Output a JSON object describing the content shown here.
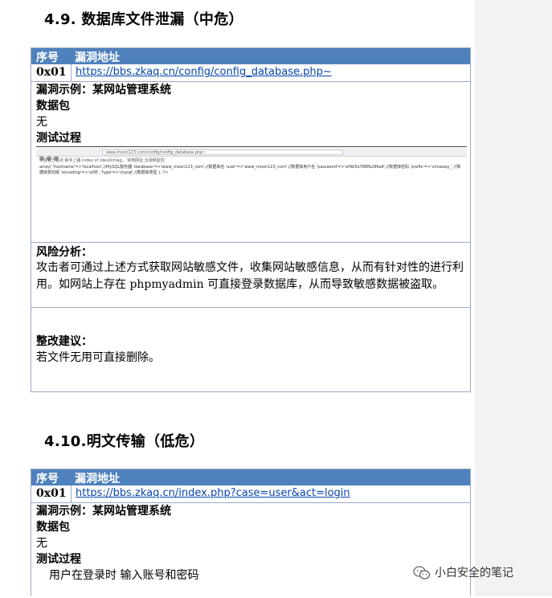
{
  "sections": [
    {
      "heading": "4.9. 数据库文件泄漏（中危）",
      "table": {
        "header": {
          "col1": "序号",
          "col2": "漏洞地址"
        },
        "row": {
          "id": "0x01",
          "url": "https://bbs.zkaq.cn/config/config_database.php~"
        },
        "example": "漏洞示例：某网站管理系统",
        "packet_label": "数据包",
        "packet_value": "无",
        "process_label": "测试过程",
        "screenshot": {
          "address": "www.moon123.com/config/config_database.php~",
          "bookmarks": "火狐官方站点   新手上路   Index of /devil/imag...   常用网址   云视频监控",
          "output": "array( 'hostname'=>'localhost',//MySQL服务器 'database'=>'www_moon123_com',//数据库名 'user'=>'www_moon123_com',//数据库用户名 'password'=>'ef4b5e788fb286a4',//数据库密码 'prefix'=>'cmseasy_',//数据库表前缀 'encoding'=>'utf8', 'type'=>'mysql',//数据库类型 ); ?>"
        },
        "risk_label": "风险分析：",
        "risk_text": "攻击者可通过上述方式获取网站敏感文件，收集网站敏感信息，从而有针对性的进行利用。如网站上存在 phpmyadmin 可直接登录数据库，从而导致敏感数据被盗取。",
        "fix_label": "整改建议：",
        "fix_text": "若文件无用可直接删除。"
      }
    },
    {
      "heading": "4.10.明文传输（低危）",
      "table": {
        "header": {
          "col1": "序号",
          "col2": "漏洞地址"
        },
        "row": {
          "id": "0x01",
          "url": "https://bbs.zkaq.cn/index.php?case=user&act=login"
        },
        "example": "漏洞示例：某网站管理系统",
        "packet_label": "数据包",
        "packet_value": "无",
        "process_label": "测试过程",
        "process_text": "用户在登录时 输入账号和密码"
      }
    }
  ],
  "watermark": "小白安全的笔记"
}
